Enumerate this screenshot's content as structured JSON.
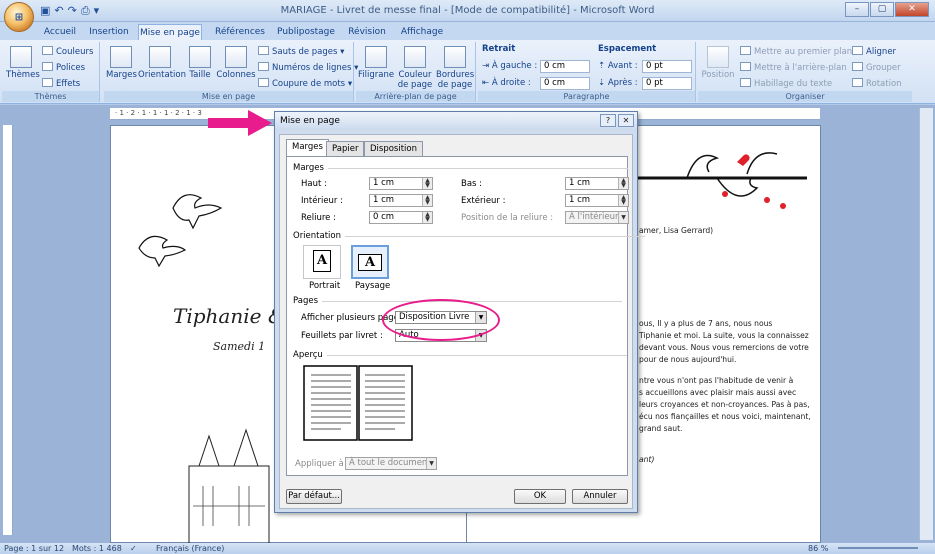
{
  "window": {
    "title": "MARIAGE - Livret de messe final - [Mode de compatibilité] - Microsoft Word",
    "office_button": "⊞",
    "controls": {
      "minimize": "–",
      "maximize": "▢",
      "close": "✕"
    }
  },
  "tabs": [
    "Accueil",
    "Insertion",
    "Mise en page",
    "Références",
    "Publipostage",
    "Révision",
    "Affichage"
  ],
  "ribbon": {
    "themes": {
      "title": "Thèmes",
      "big": "Thèmes",
      "couleurs": "Couleurs",
      "polices": "Polices",
      "effets": "Effets"
    },
    "mise_en_page": {
      "title": "Mise en page",
      "marges": "Marges",
      "orientation": "Orientation",
      "taille": "Taille",
      "colonnes": "Colonnes",
      "sauts": "Sauts de pages",
      "numeros": "Numéros de lignes",
      "coupure": "Coupure de mots"
    },
    "arriere_plan": {
      "title": "Arrière-plan de page",
      "filigrane": "Filigrane",
      "couleur_l1": "Couleur",
      "couleur_l2": "de page",
      "bordures_l1": "Bordures",
      "bordures_l2": "de page"
    },
    "paragraphe": {
      "title": "Paragraphe",
      "retrait": "Retrait",
      "gauche_label": "À gauche :",
      "gauche_value": "0 cm",
      "droite_label": "À droite :",
      "droite_value": "0 cm",
      "espacement": "Espacement",
      "avant_label": "Avant :",
      "avant_value": "0 pt",
      "apres_label": "Après :",
      "apres_value": "0 pt"
    },
    "organiser": {
      "title": "Organiser",
      "position": "Position",
      "premier_plan": "Mettre au premier plan",
      "arriere_plan": "Mettre à l'arrière-plan",
      "habillage": "Habillage du texte",
      "aligner": "Aligner",
      "grouper": "Grouper",
      "rotation": "Rotation"
    }
  },
  "document": {
    "names": "Tiphanie &",
    "date": "Samedi 1",
    "right_page": {
      "line1": "amer, Lisa Gerrard)",
      "para1": [
        "ous, Il y a plus de 7 ans, nous nous",
        "Tiphanie et moi. La suite, vous la connaissez",
        "devant vous. Nous vous remercions de votre",
        "pour de nous aujourd'hui."
      ],
      "para2": [
        "ntre vous n'ont pas l'habitude de venir à",
        "s accueillons avec plaisir mais aussi avec",
        "leurs croyances et non-croyances. Pas à pas,",
        "écu nos fiançailles et nous voici, maintenant,",
        "grand saut."
      ],
      "line_end": "ant)"
    }
  },
  "dialog": {
    "title": "Mise en page",
    "help": "?",
    "close": "✕",
    "tabs": [
      "Marges",
      "Papier",
      "Disposition"
    ],
    "marges": {
      "section": "Marges",
      "haut_label": "Haut :",
      "haut": "1 cm",
      "bas_label": "Bas :",
      "bas": "1 cm",
      "interieur_label": "Intérieur :",
      "interieur": "1 cm",
      "exterieur_label": "Extérieur :",
      "exterieur": "1 cm",
      "reliure_label": "Reliure :",
      "reliure": "0 cm",
      "position_reliure_label": "Position de la reliure :",
      "position_reliure": "À l'intérieur"
    },
    "orientation": {
      "section": "Orientation",
      "portrait": "Portrait",
      "paysage": "Paysage",
      "portrait_glyph": "A",
      "paysage_glyph": "A"
    },
    "pages": {
      "section": "Pages",
      "plusieurs_label": "Afficher plusieurs pages :",
      "plusieurs_value": "Disposition Livre",
      "feuillets_label": "Feuillets par livret :",
      "feuillets_value": "Auto"
    },
    "apercu": {
      "section": "Aperçu"
    },
    "appliquer_label": "Appliquer à :",
    "appliquer_value": "À tout le document",
    "buttons": {
      "defaut": "Par défaut...",
      "ok": "OK",
      "annuler": "Annuler"
    }
  },
  "status": {
    "page": "Page : 1 sur 12",
    "mots": "Mots : 1 468",
    "langue": "Français (France)",
    "zoom": "86 %"
  },
  "colors": {
    "annotation": "#e81c8c",
    "heart": "#e0202a"
  }
}
